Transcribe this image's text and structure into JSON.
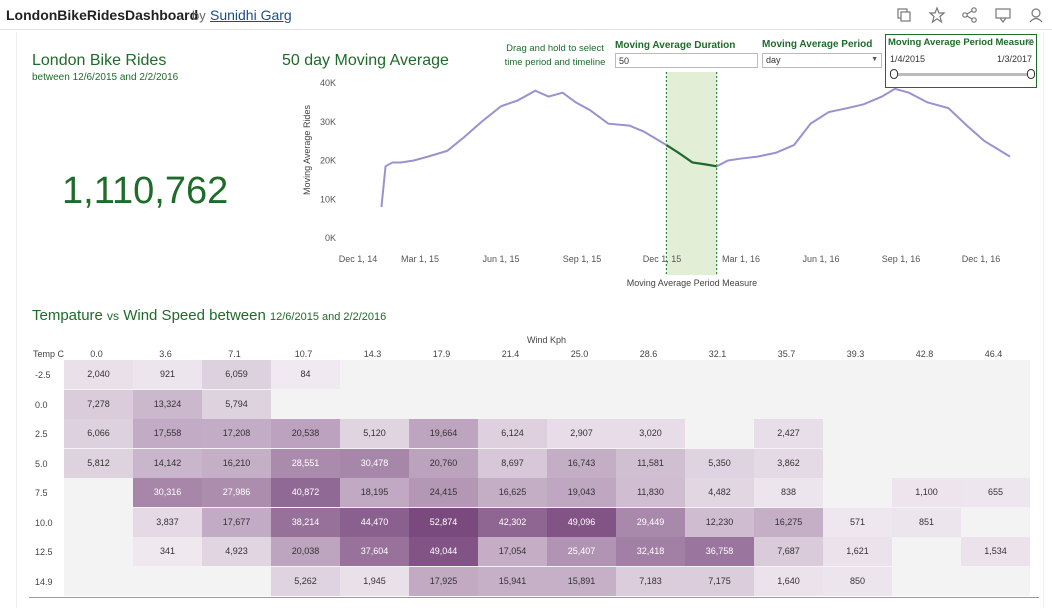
{
  "header": {
    "title": "LondonBikeRidesDashboard",
    "by": "by",
    "author": "Sunidhi Garg",
    "icons": [
      "copy-icon",
      "star-icon",
      "share-icon",
      "download-icon",
      "account-icon"
    ]
  },
  "kpi": {
    "title": "London Bike Rides",
    "subtitle": "between 12/6/2015 and 2/2/2016",
    "value": "1,110,762"
  },
  "moving_average": {
    "title": "50 day Moving Average",
    "hint": "Drag and hold to select time period and timeline",
    "duration_label": "Moving Average Duration",
    "duration_value": "50",
    "period_label": "Moving Average Period",
    "period_value": "day",
    "measure_label": "Moving Average Period Measure",
    "measure_from": "1/4/2015",
    "measure_to": "1/3/2017"
  },
  "colors": {
    "accent_green": "#1e6b2a",
    "line_purple": "#9c90cf",
    "highlight_green": "#e3eed6",
    "heat_low": "#f1eaf1",
    "heat_high": "#7a4a7e"
  },
  "chart_data": [
    {
      "type": "line",
      "title": "50 day Moving Average",
      "xlabel": "Moving Average Period Measure",
      "ylabel": "Moving Average Rides",
      "y_ticks": [
        "0K",
        "10K",
        "20K",
        "30K",
        "40K"
      ],
      "ylim": [
        0,
        40000
      ],
      "x_ticks": [
        "Dec 1, 14",
        "Mar 1, 15",
        "Jun 1, 15",
        "Sep 1, 15",
        "Dec 1, 15",
        "Mar 1, 16",
        "Jun 1, 16",
        "Sep 1, 16",
        "Dec 1, 16"
      ],
      "x_tick_dates": [
        "2014-12-01",
        "2015-03-01",
        "2015-06-01",
        "2015-09-01",
        "2015-12-01",
        "2016-03-01",
        "2016-06-01",
        "2016-09-01",
        "2016-12-01"
      ],
      "highlight_range": [
        "2015-12-06",
        "2016-02-02"
      ],
      "series": [
        {
          "x": [
            "2015-01-04",
            "2015-01-10",
            "2015-01-20",
            "2015-02-01",
            "2015-02-20",
            "2015-03-10",
            "2015-04-01",
            "2015-04-20",
            "2015-05-10",
            "2015-06-01",
            "2015-06-20",
            "2015-07-10",
            "2015-07-25",
            "2015-08-10",
            "2015-08-25",
            "2015-09-10",
            "2015-10-01",
            "2015-10-25",
            "2015-11-10",
            "2015-12-06",
            "2015-12-20",
            "2016-01-05",
            "2016-01-20",
            "2016-02-02",
            "2016-02-15",
            "2016-03-01",
            "2016-03-20",
            "2016-04-10",
            "2016-05-01",
            "2016-05-20",
            "2016-06-10",
            "2016-07-01",
            "2016-07-20",
            "2016-08-10",
            "2016-08-25",
            "2016-09-10",
            "2016-10-01",
            "2016-10-25",
            "2016-11-15",
            "2016-12-05",
            "2017-01-03"
          ],
          "values": [
            8000,
            18500,
            19500,
            19500,
            20000,
            21000,
            22500,
            26000,
            30000,
            34000,
            35500,
            38000,
            36500,
            37500,
            35000,
            33000,
            29500,
            29000,
            27500,
            24000,
            22000,
            19500,
            19000,
            18500,
            20000,
            20500,
            21000,
            22000,
            24000,
            29500,
            32500,
            33500,
            34500,
            36500,
            38500,
            37500,
            35000,
            33500,
            29000,
            25000,
            21000
          ]
        }
      ]
    },
    {
      "type": "heatmap",
      "title": "Tempature vs Wind Speed",
      "subtitle": "between 12/6/2015 and 2/2/2016",
      "vs_word": "vs",
      "between_word": "between",
      "xlabel": "Wind Kph",
      "ylabel": "Temp C",
      "x": [
        "0.0",
        "3.6",
        "7.1",
        "10.7",
        "14.3",
        "17.9",
        "21.4",
        "25.0",
        "28.6",
        "32.1",
        "35.7",
        "39.3",
        "42.8",
        "46.4"
      ],
      "y": [
        "-2.5",
        "0.0",
        "2.5",
        "5.0",
        "7.5",
        "10.0",
        "12.5",
        "14.9"
      ],
      "values": [
        [
          2040,
          921,
          6059,
          84,
          null,
          null,
          null,
          null,
          null,
          null,
          null,
          null,
          null,
          null
        ],
        [
          7278,
          13324,
          5794,
          null,
          null,
          null,
          null,
          null,
          null,
          null,
          null,
          null,
          null,
          null
        ],
        [
          6066,
          17558,
          17208,
          20538,
          5120,
          19664,
          6124,
          2907,
          3020,
          null,
          2427,
          null,
          null,
          null
        ],
        [
          5812,
          14142,
          16210,
          28551,
          30478,
          20760,
          8697,
          16743,
          11581,
          5350,
          3862,
          null,
          null,
          null
        ],
        [
          null,
          30316,
          27986,
          40872,
          18195,
          24415,
          16625,
          19043,
          11830,
          4482,
          838,
          null,
          1100,
          655
        ],
        [
          null,
          3837,
          17677,
          38214,
          44470,
          52874,
          42302,
          49096,
          29449,
          12230,
          16275,
          571,
          851,
          null
        ],
        [
          null,
          341,
          4923,
          20038,
          37604,
          49044,
          17054,
          25407,
          32418,
          36758,
          7687,
          1621,
          null,
          1534
        ],
        [
          null,
          null,
          null,
          5262,
          1945,
          17925,
          15941,
          15891,
          7183,
          7175,
          1640,
          850,
          null,
          null
        ]
      ],
      "value_labels": [
        [
          "2,040",
          "921",
          "6,059",
          "84",
          "",
          "",
          "",
          "",
          "",
          "",
          "",
          "",
          "",
          ""
        ],
        [
          "7,278",
          "13,324",
          "5,794",
          "",
          "",
          "",
          "",
          "",
          "",
          "",
          "",
          "",
          "",
          ""
        ],
        [
          "6,066",
          "17,558",
          "17,208",
          "20,538",
          "5,120",
          "19,664",
          "6,124",
          "2,907",
          "3,020",
          "",
          "2,427",
          "",
          "",
          ""
        ],
        [
          "5,812",
          "14,142",
          "16,210",
          "28,551",
          "30,478",
          "20,760",
          "8,697",
          "16,743",
          "11,581",
          "5,350",
          "3,862",
          "",
          "",
          ""
        ],
        [
          "",
          "30,316",
          "27,986",
          "40,872",
          "18,195",
          "24,415",
          "16,625",
          "19,043",
          "11,830",
          "4,482",
          "838",
          "",
          "1,100",
          "655"
        ],
        [
          "",
          "3,837",
          "17,677",
          "38,214",
          "44,470",
          "52,874",
          "42,302",
          "49,096",
          "29,449",
          "12,230",
          "16,275",
          "571",
          "851",
          ""
        ],
        [
          "",
          "341",
          "4,923",
          "20,038",
          "37,604",
          "49,044",
          "17,054",
          "25,407",
          "32,418",
          "36,758",
          "7,687",
          "1,621",
          "",
          "1,534"
        ],
        [
          "",
          "",
          "",
          "5,262",
          "1,945",
          "17,925",
          "15,941",
          "15,891",
          "7,183",
          "7,175",
          "1,640",
          "850",
          "",
          ""
        ]
      ]
    }
  ]
}
